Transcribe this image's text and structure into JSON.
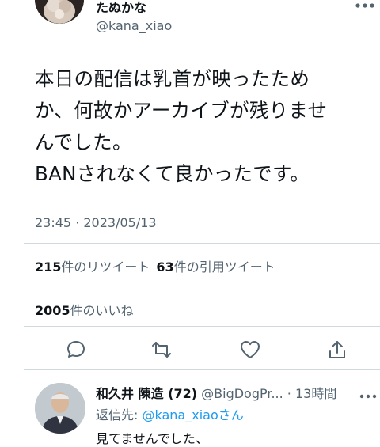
{
  "author": {
    "display_name": "たぬかな",
    "handle": "@kana_xiao"
  },
  "tweet": {
    "text": "本日の配信は乳首が映ったため\nか、何故かアーカイブが残りませ\nんでした。\nBANされなくて良かったです。",
    "timestamp": "23:45 · 2023/05/13"
  },
  "stats": {
    "retweets_count": "215",
    "retweets_label": "件のリツイート",
    "quotes_count": "63",
    "quotes_label": "件の引用ツイート",
    "likes_count": "2005",
    "likes_label": "件のいいね"
  },
  "actions": [
    "reply-icon",
    "retweet-icon",
    "like-icon",
    "share-icon"
  ],
  "reply": {
    "display_name": "和久井 陳造 (72)",
    "handle_time": "@BigDogPr... · 13時間",
    "replying_to_label": "返信先: ",
    "replying_to_handle": "@kana_xiao",
    "replying_to_suffix": "さん",
    "text": "見てませんでした、"
  },
  "colors": {
    "text": "#0f1419",
    "secondary": "#536471",
    "link": "#1d9bf0",
    "divider": "#cfd9de"
  }
}
